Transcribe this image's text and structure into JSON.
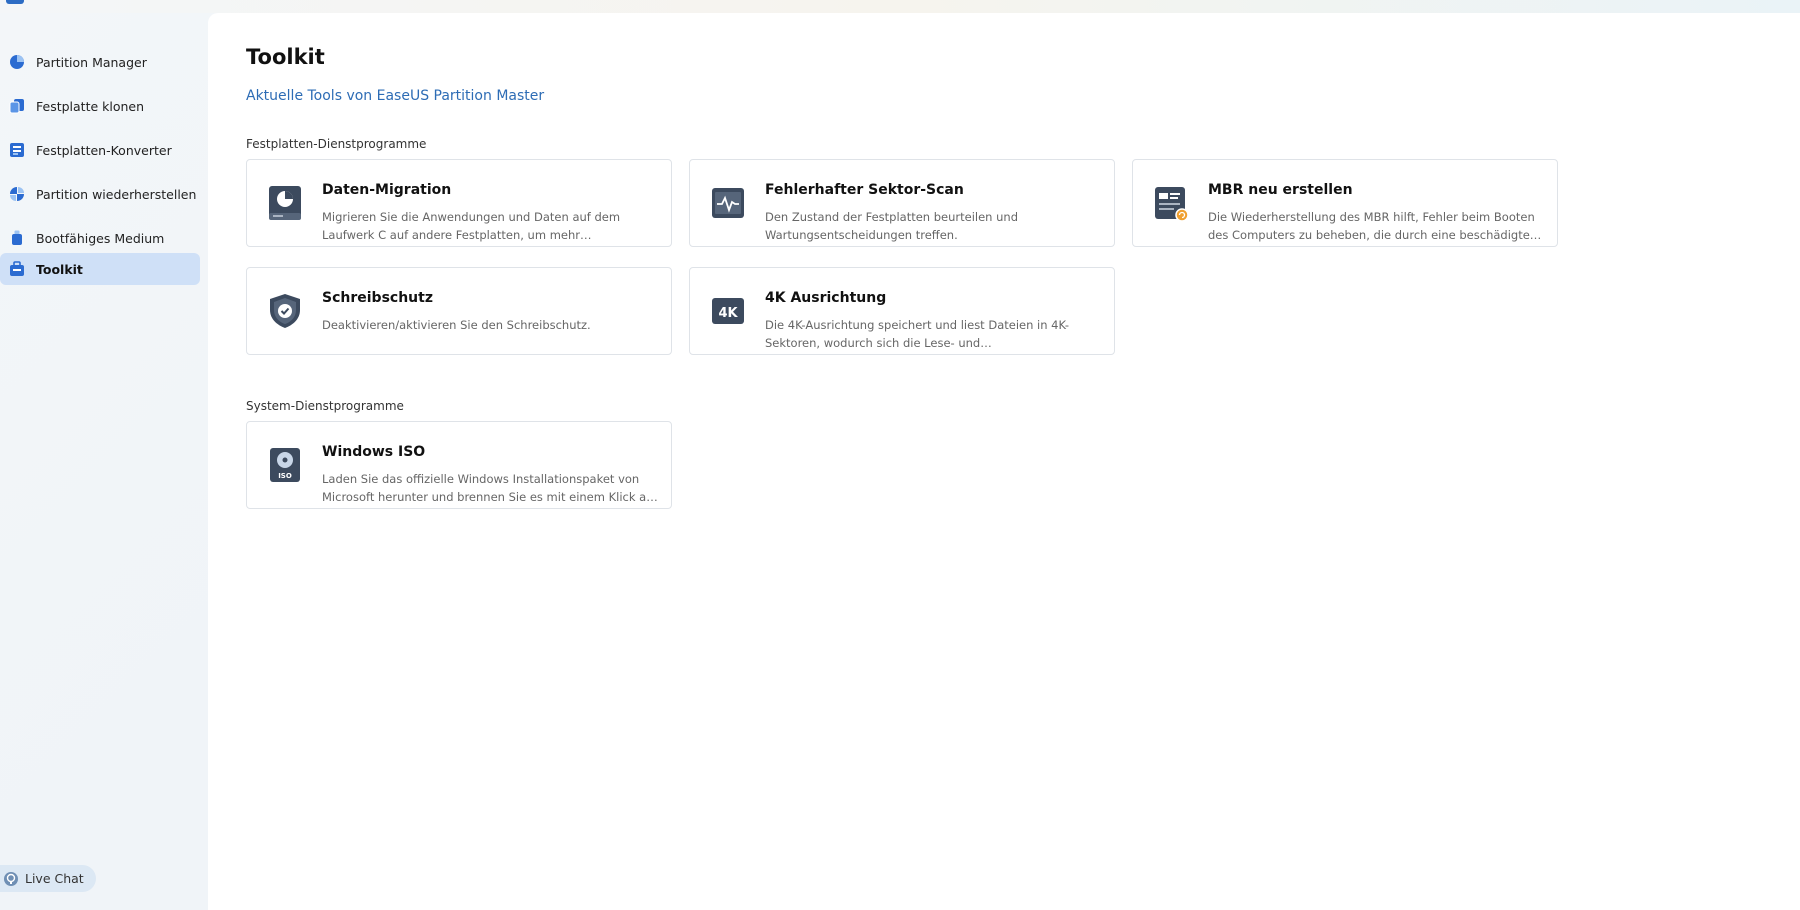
{
  "sidebar": {
    "items": [
      {
        "label": "Partition Manager",
        "icon": "pie-chart-icon"
      },
      {
        "label": "Festplatte klonen",
        "icon": "clone-icon"
      },
      {
        "label": "Festplatten-Konverter",
        "icon": "converter-icon"
      },
      {
        "label": "Partition wiederherstellen",
        "icon": "recover-icon"
      },
      {
        "label": "Bootfähiges Medium",
        "icon": "usb-icon"
      },
      {
        "label": "Toolkit",
        "icon": "toolkit-icon",
        "active": true
      }
    ],
    "live_chat": "Live Chat"
  },
  "main": {
    "title": "Toolkit",
    "subtitle": "Aktuelle Tools von EaseUS Partition Master",
    "sections": [
      {
        "label": "Festplatten-Dienstprogramme",
        "cards": [
          {
            "title": "Daten-Migration",
            "desc": "Migrieren Sie die Anwendungen und Daten auf dem Laufwerk C auf andere Festplatten, um mehr Speicherplatz freizugeben.",
            "icon": "data-migration-icon"
          },
          {
            "title": "Fehlerhafter Sektor-Scan",
            "desc": "Den Zustand der Festplatten beurteilen und Wartungsentscheidungen treffen.",
            "icon": "sector-scan-icon"
          },
          {
            "title": "MBR neu erstellen",
            "desc": "Die Wiederherstellung des MBR hilft, Fehler beim Booten des Computers zu beheben, die durch eine beschädigte MBR verursacht werden.",
            "icon": "mbr-icon"
          },
          {
            "title": "Schreibschutz",
            "desc": "Deaktivieren/aktivieren Sie den Schreibschutz.",
            "icon": "shield-check-icon"
          },
          {
            "title": "4K Ausrichtung",
            "desc": "Die 4K-Ausrichtung speichert und liest Dateien in 4K-Sektoren, wodurch sich die Lese- und Schreibgeschwindigkeit erhöht.",
            "icon": "4k-icon"
          }
        ]
      },
      {
        "label": "System-Dienstprogramme",
        "cards": [
          {
            "title": "Windows ISO",
            "desc": "Laden Sie das offizielle Windows Installationspaket von Microsoft herunter und brennen Sie es mit einem Klick auf ein USB-Laufwerk.",
            "icon": "iso-icon"
          }
        ]
      }
    ]
  },
  "colors": {
    "accent": "#2d6cb5",
    "active_nav": "#cfe0f7",
    "icon_dark": "#3c4a5e",
    "mbr_badge": "#f0a030"
  }
}
